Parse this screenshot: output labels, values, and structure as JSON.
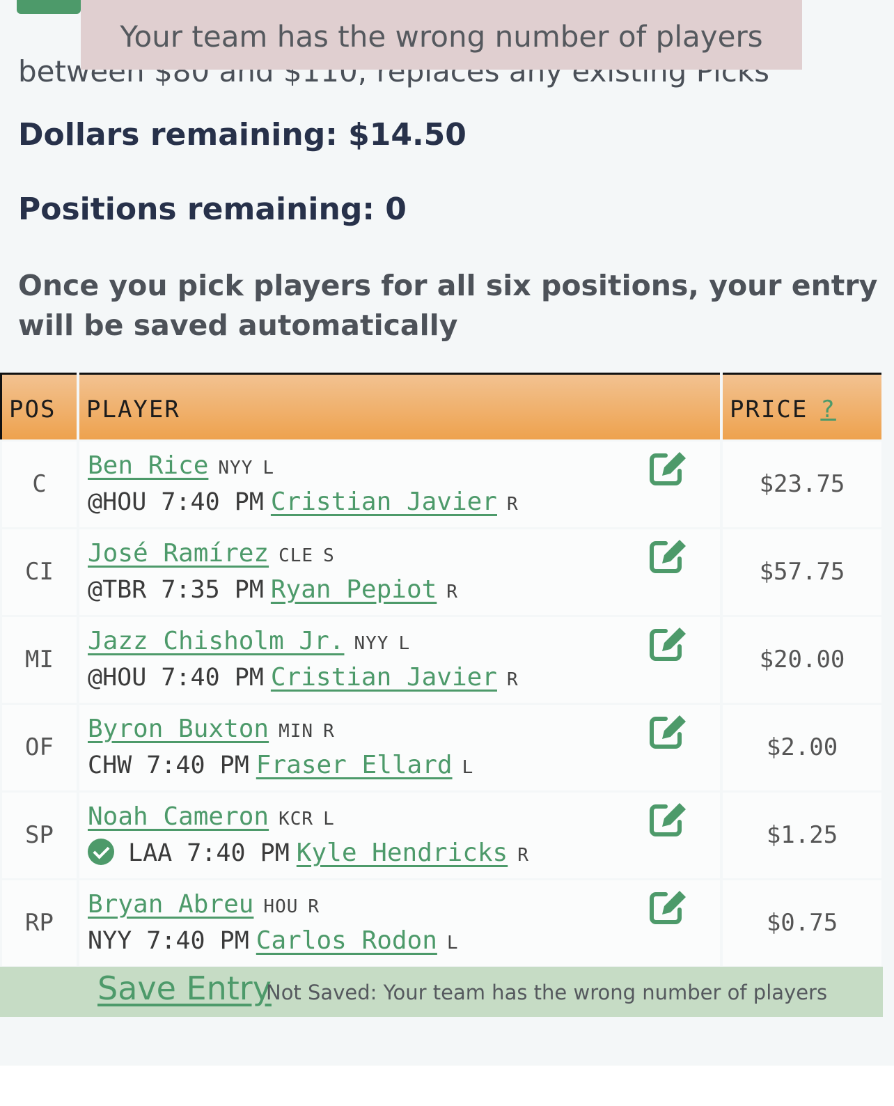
{
  "intro_text": "between $80 and $110, replaces any existing Picks",
  "toast_message": "Your team has the wrong number of players",
  "dollars_remaining": "Dollars remaining: $14.50",
  "positions_remaining": "Positions remaining: 0",
  "instructions": "Once you pick players for all six positions, your entry will be saved automatically",
  "table": {
    "headers": {
      "pos": "POS",
      "player": "PLAYER",
      "price": "PRICE",
      "help": "?"
    },
    "rows": [
      {
        "pos": "C",
        "player": "Ben Rice",
        "team": "NYY",
        "hand": "L",
        "check": false,
        "game": "@HOU 7:40 PM",
        "opponent": "Cristian Javier",
        "opp_hand": "R",
        "price": "$23.75"
      },
      {
        "pos": "CI",
        "player": "José Ramírez",
        "team": "CLE",
        "hand": "S",
        "check": false,
        "game": "@TBR 7:35 PM",
        "opponent": "Ryan Pepiot",
        "opp_hand": "R",
        "price": "$57.75"
      },
      {
        "pos": "MI",
        "player": "Jazz Chisholm Jr.",
        "team": "NYY",
        "hand": "L",
        "check": false,
        "game": "@HOU 7:40 PM",
        "opponent": "Cristian Javier",
        "opp_hand": "R",
        "price": "$20.00"
      },
      {
        "pos": "OF",
        "player": "Byron Buxton",
        "team": "MIN",
        "hand": "R",
        "check": false,
        "game": "CHW 7:40 PM",
        "opponent": "Fraser Ellard",
        "opp_hand": "L",
        "price": "$2.00"
      },
      {
        "pos": "SP",
        "player": "Noah Cameron",
        "team": "KCR",
        "hand": "L",
        "check": true,
        "game": "LAA 7:40 PM",
        "opponent": "Kyle Hendricks",
        "opp_hand": "R",
        "price": "$1.25"
      },
      {
        "pos": "RP",
        "player": "Bryan Abreu",
        "team": "HOU",
        "hand": "R",
        "check": false,
        "game": "NYY 7:40 PM",
        "opponent": "Carlos Rodon",
        "opp_hand": "L",
        "price": "$0.75"
      }
    ]
  },
  "save": {
    "label": "Save Entry",
    "status": "Not Saved: Your team has the wrong number of players"
  },
  "colors": {
    "accent_green": "#4d9a6a",
    "header_orange": "#eea24e",
    "save_bar": "#c6dcc5",
    "toast_bg": "#e0cfd0"
  }
}
